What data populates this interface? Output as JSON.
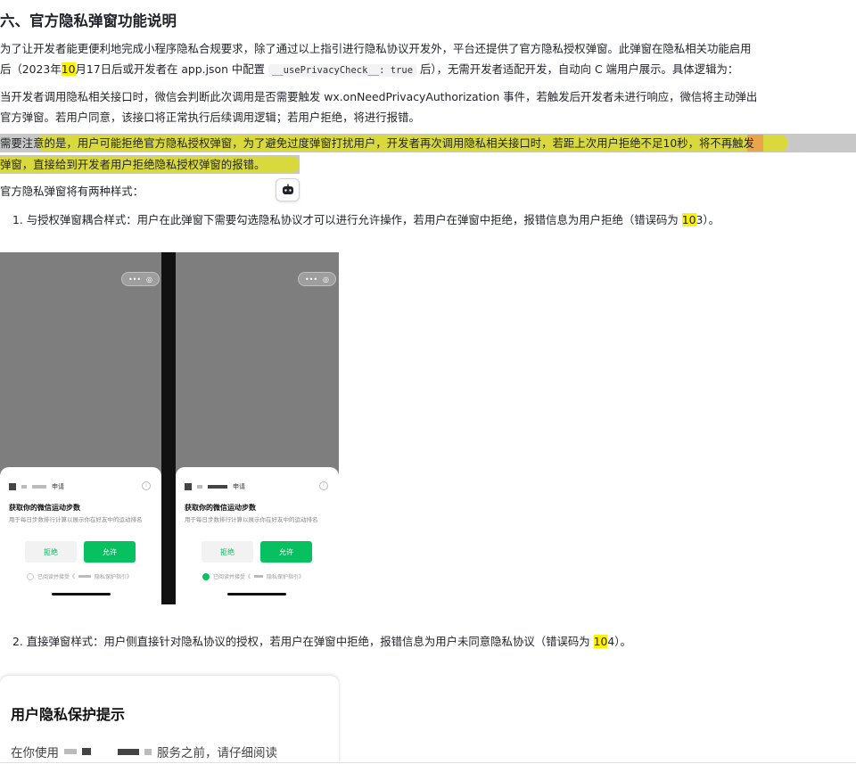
{
  "section_title": "六、官方隐私弹窗功能说明",
  "intro": {
    "line1": "为了让开发者能更便利地完成小程序隐私合规要求，除了通过以上指引进行隐私协议开发外，平台还提供了官方隐私授权弹窗。此弹窗在隐私相关功能启用",
    "line2_a": "后（2023年",
    "line2_hl": "10",
    "line2_b": "月17日后或开发者在 app.json 中配置 ",
    "line2_code": "__usePrivacyCheck__: true",
    "line2_c": " 后），无需开发者适配开发，自动向 C 端用户展示。具体逻辑为："
  },
  "logic": {
    "line1": "当开发者调用隐私相关接口时，微信会判断此次调用是否需要触发 wx.onNeedPrivacyAuthorization 事件，若触发后开发者未进行响应，微信将主动弹出",
    "line2": "官方弹窗。若用户同意，该接口将正常执行后续调用逻辑；若用户拒绝，将进行报错。"
  },
  "note": {
    "line1_a": "需要注意的是，用户可能拒绝官方隐私授权弹窗，为了避免过度弹窗打扰用户，开发者再次调用隐私相关接口时，若距上次用户拒绝不足",
    "line1_hl": "10",
    "line1_b": "秒，将不再触发",
    "line2": "弹窗，直接给到开发者用户拒绝隐私授权弹窗的报错。"
  },
  "styles_intro": "官方隐私弹窗将有两种样式：",
  "item1": {
    "text_a": "1. 与授权弹窗耦合样式：用户在此弹窗下需要勾选隐私协议才可以进行允许操作，若用户在弹窗中拒绝，报错信息为用户拒绝（错误码为 ",
    "code_hl": "10",
    "code_rest": "3",
    "text_b": "）。"
  },
  "phone_mock": {
    "capsule_dots": "•••",
    "capsule_target": "◎",
    "apply_label": "申请",
    "info_glyph": "i",
    "title": "获取你的微信运动步数",
    "subtitle": "用于每日步数排行计算以展示你在好友中的运动排名",
    "reject": "拒绝",
    "allow": "允许",
    "agree_prefix": "已阅读并接受《",
    "agree_suffix": "隐私保护指引》"
  },
  "item2": {
    "text_a": "2. 直接弹窗样式：用户侧直接针对隐私协议的授权，若用户在弹窗中拒绝，报错信息为用户未同意隐私协议（错误码为 ",
    "code_hl": "10",
    "code_rest": "4",
    "text_b": "）。"
  },
  "dialog2": {
    "title": "用户隐私保护提示",
    "body_a": "在你使用",
    "body_b": "服务之前，请仔细阅读"
  },
  "colors": {
    "highlight": "#fff200",
    "selection": "#c8c8c8",
    "mark": "#d9d93d",
    "wechat_green": "#07c160"
  },
  "icons": {
    "float_button": "robot-icon"
  }
}
